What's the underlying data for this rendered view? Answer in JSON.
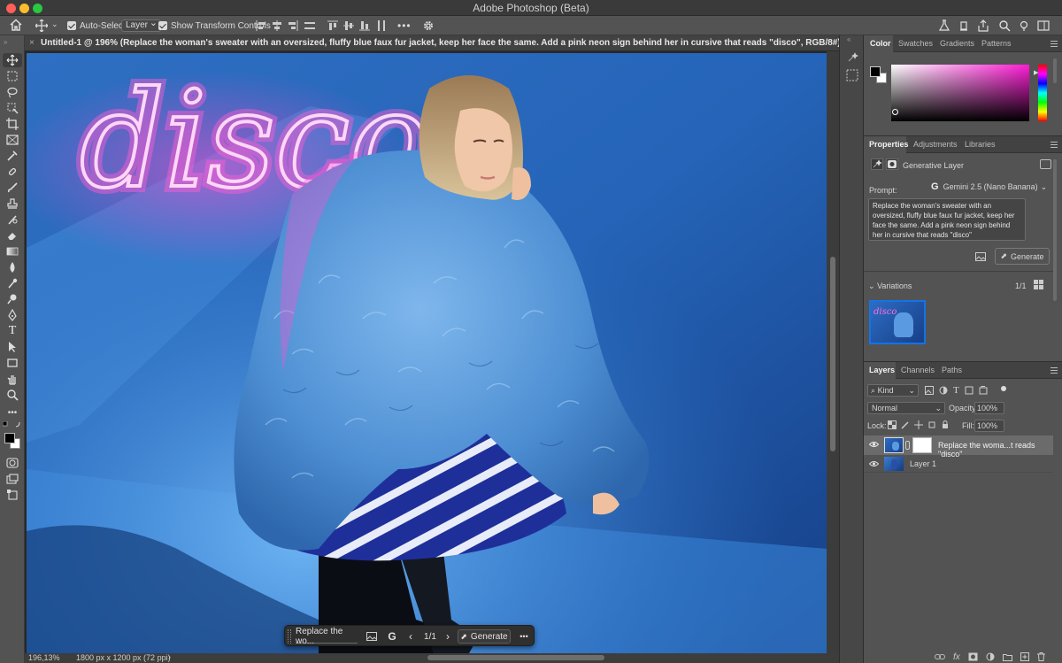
{
  "window": {
    "title": "Adobe Photoshop (Beta)",
    "traffic_colors": [
      "#ff5f57",
      "#febc2e",
      "#28c840"
    ]
  },
  "options_bar": {
    "auto_select_label": "Auto-Select:",
    "auto_select_value": "Layer",
    "show_transform_label": "Show Transform Controls",
    "more": "•••"
  },
  "document": {
    "tab_title": "Untitled-1 @ 196% (Replace the woman's sweater with an oversized, fluffy blue faux fur jacket, keep her face the same. Add a pink neon sign behind her in cursive that reads \"disco\", RGB/8#) *",
    "neon_text": "disco",
    "zoom": "196,13%",
    "doc_info": "1800 px x 1200 px (72 ppi)"
  },
  "taskbar": {
    "prompt_preview": "Replace the wo...",
    "counter": "1/1",
    "generate_label": "Generate",
    "more": "•••"
  },
  "color_panel": {
    "tabs": [
      "Color",
      "Swatches",
      "Gradients",
      "Patterns"
    ],
    "active_tab": "Color"
  },
  "properties_panel": {
    "tabs": [
      "Properties",
      "Adjustments",
      "Libraries"
    ],
    "layer_type": "Generative Layer",
    "prompt_label": "Prompt:",
    "model": "Gemini 2.5 (Nano Banana)",
    "prompt_text": "Replace the woman's sweater with an oversized, fluffy blue faux fur jacket, keep her face the same. Add a pink neon sign behind her in cursive that reads \"disco\"",
    "generate_label": "Generate",
    "variations_label": "Variations",
    "variations_count": "1/1",
    "thumb_text": "disco"
  },
  "layers_panel": {
    "tabs": [
      "Layers",
      "Channels",
      "Paths"
    ],
    "kind_label": "Kind",
    "blend_mode": "Normal",
    "opacity_label": "Opacity:",
    "opacity_value": "100%",
    "lock_label": "Lock:",
    "fill_label": "Fill:",
    "fill_value": "100%",
    "layers": [
      {
        "name": "Replace the woma...t reads \"disco\"",
        "selected": true
      },
      {
        "name": "Layer 1",
        "selected": false
      }
    ],
    "footer_icons": [
      "link-icon",
      "fx-icon",
      "mask-icon",
      "adjustment-icon",
      "folder-icon",
      "new-layer-icon",
      "trash-icon"
    ],
    "fx_label": "fx"
  },
  "colors": {
    "accent": "#1473e6",
    "neon_pink": "#ff3fc8",
    "fur_blue": "#4a8fd6"
  }
}
